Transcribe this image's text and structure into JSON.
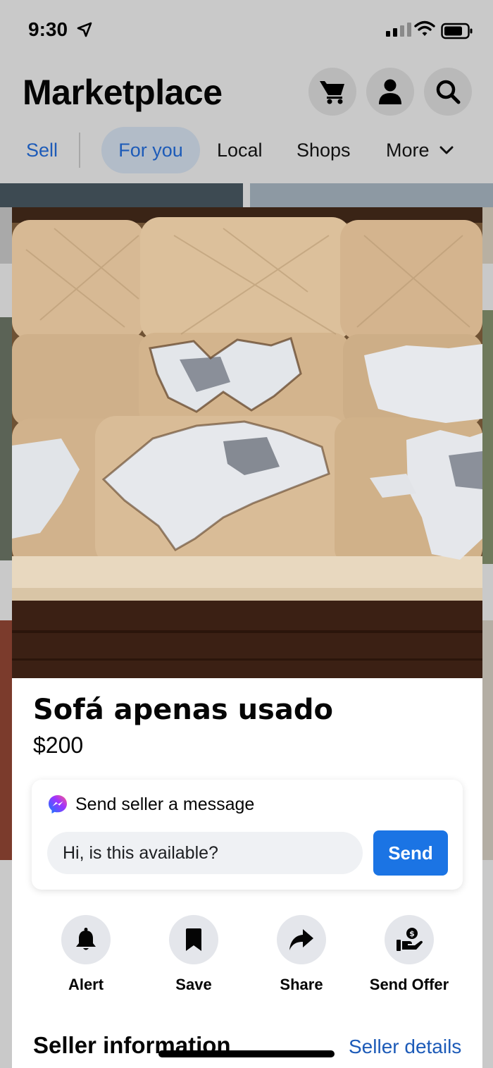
{
  "status_bar": {
    "time": "9:30"
  },
  "header": {
    "title": "Marketplace"
  },
  "tabs": {
    "sell": "Sell",
    "items": [
      "For you",
      "Local",
      "Shops",
      "More"
    ]
  },
  "listing": {
    "title": "Sofá apenas usado",
    "price": "$200"
  },
  "message": {
    "heading": "Send seller a message",
    "input_value": "Hi, is this available?",
    "send_label": "Send"
  },
  "actions": [
    {
      "label": "Alert",
      "icon": "bell-icon"
    },
    {
      "label": "Save",
      "icon": "bookmark-icon"
    },
    {
      "label": "Share",
      "icon": "share-icon"
    },
    {
      "label": "Send Offer",
      "icon": "send-offer-icon"
    }
  ],
  "seller": {
    "heading": "Seller information",
    "link": "Seller details"
  },
  "colors": {
    "accent": "#1b74e4",
    "link": "#1d5bb8",
    "dim_background": "#c9c9c9"
  }
}
